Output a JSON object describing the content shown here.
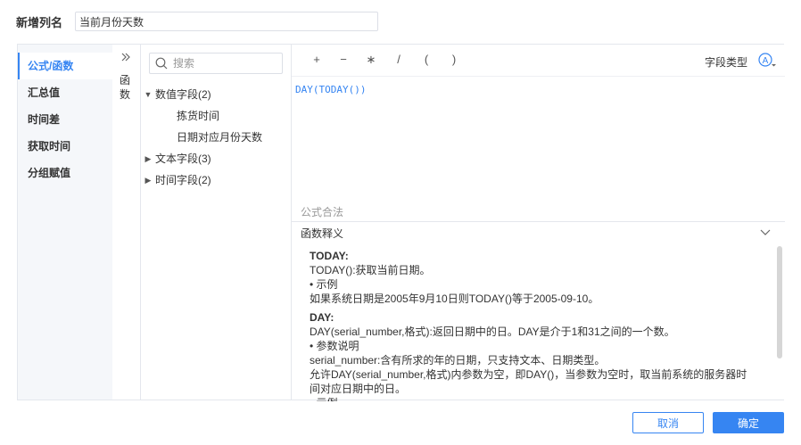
{
  "header": {
    "label": "新增列名",
    "value": "当前月份天数"
  },
  "nav": {
    "items": [
      "公式/函数",
      "汇总值",
      "时间差",
      "获取时间",
      "分组赋值"
    ],
    "active": 0
  },
  "collapse": {
    "vertical_label": [
      "函",
      "数"
    ]
  },
  "fields": {
    "search_placeholder": "搜索",
    "groups": [
      {
        "label": "数值字段(2)",
        "expanded": true,
        "children": [
          "拣货时间",
          "日期对应月份天数"
        ]
      },
      {
        "label": "文本字段(3)",
        "expanded": false,
        "children": []
      },
      {
        "label": "时间字段(2)",
        "expanded": false,
        "children": []
      }
    ]
  },
  "editor": {
    "operators": [
      "+",
      "−",
      "∗",
      "/",
      "(",
      ")"
    ],
    "field_type_label": "字段类型",
    "field_type_icon": "letter-a-circle-icon",
    "formula": "DAY(TODAY())",
    "valid_text": "公式合法",
    "explain_title": "函数释义",
    "explain_lines": [
      {
        "bold": true,
        "text": "TODAY:"
      },
      {
        "bold": false,
        "text": "TODAY():获取当前日期。"
      },
      {
        "bold": false,
        "text": "• 示例"
      },
      {
        "bold": false,
        "text": "如果系统日期是2005年9月10日则TODAY()等于2005-09-10。"
      },
      {
        "bold": true,
        "text": "DAY:",
        "gap": true
      },
      {
        "bold": false,
        "text": "DAY(serial_number,格式):返回日期中的日。DAY是介于1和31之间的一个数。"
      },
      {
        "bold": false,
        "text": "•  参数说明"
      },
      {
        "bold": false,
        "text": "serial_number:含有所求的年的日期，只支持文本、日期类型。"
      },
      {
        "bold": false,
        "text": "允许DAY(serial_number,格式)内参数为空，即DAY()，当参数为空时，取当前系统的服务器时"
      },
      {
        "bold": false,
        "text": "间对应日期中的日。"
      },
      {
        "bold": false,
        "text": "•  示例"
      }
    ]
  },
  "footer": {
    "cancel": "取消",
    "ok": "确定"
  },
  "colors": {
    "accent": "#3685f2",
    "nav_bg": "#f5f7fa",
    "border": "#e4e7ed"
  }
}
